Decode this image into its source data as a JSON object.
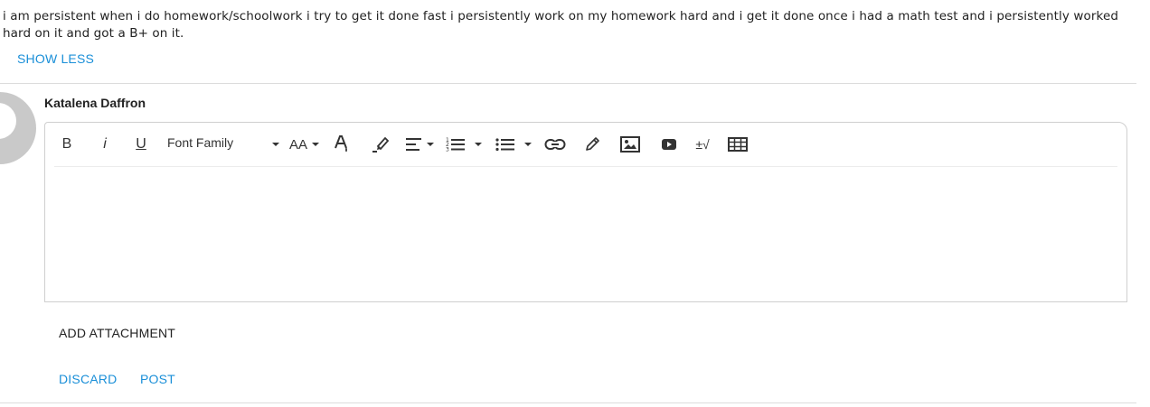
{
  "comment": {
    "text": "i am persistent when i do homework/schoolwork i try to get it done fast i persistently work on my homework hard and i get it done once i had a math test and i persistently worked hard on it and got a B+ on it.",
    "show_less_label": "SHOW LESS"
  },
  "reply": {
    "author": "Katalena Daffron",
    "toolbar": {
      "bold": "B",
      "italic": "i",
      "underline": "U",
      "font_family": "Font Family",
      "font_size": "AA",
      "formula": "±√"
    },
    "add_attachment_label": "ADD ATTACHMENT",
    "discard_label": "DISCARD",
    "post_label": "POST"
  },
  "colors": {
    "accent": "#1a8fd8",
    "divider": "#dcdcdc",
    "avatar": "#c9c9c9"
  }
}
